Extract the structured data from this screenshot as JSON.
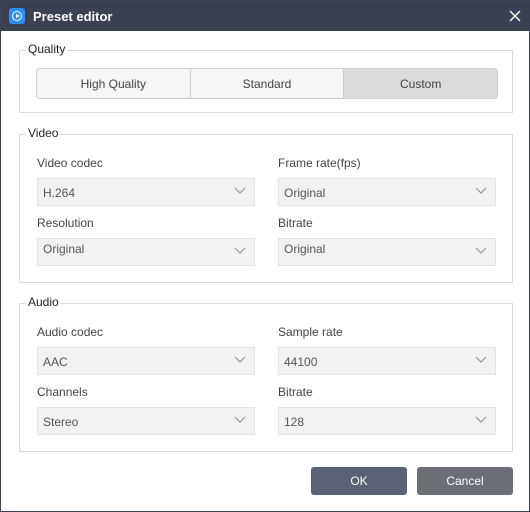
{
  "window": {
    "title": "Preset editor"
  },
  "quality": {
    "legend": "Quality",
    "options": [
      "High Quality",
      "Standard",
      "Custom"
    ],
    "selected": "Custom"
  },
  "video": {
    "legend": "Video",
    "codec_label": "Video codec",
    "codec_value": "H.264",
    "framerate_label": "Frame rate(fps)",
    "framerate_value": "Original",
    "resolution_label": "Resolution",
    "resolution_value": "Original",
    "bitrate_label": "Bitrate",
    "bitrate_value": "Original"
  },
  "audio": {
    "legend": "Audio",
    "codec_label": "Audio codec",
    "codec_value": "AAC",
    "samplerate_label": "Sample rate",
    "samplerate_value": "44100",
    "channels_label": "Channels",
    "channels_value": "Stereo",
    "bitrate_label": "Bitrate",
    "bitrate_value": "128"
  },
  "buttons": {
    "ok": "OK",
    "cancel": "Cancel"
  },
  "colors": {
    "titlebar": "#3b4150",
    "accent": "#2e8ef0",
    "ok_button": "#5c6275",
    "cancel_button": "#6b6e76"
  }
}
